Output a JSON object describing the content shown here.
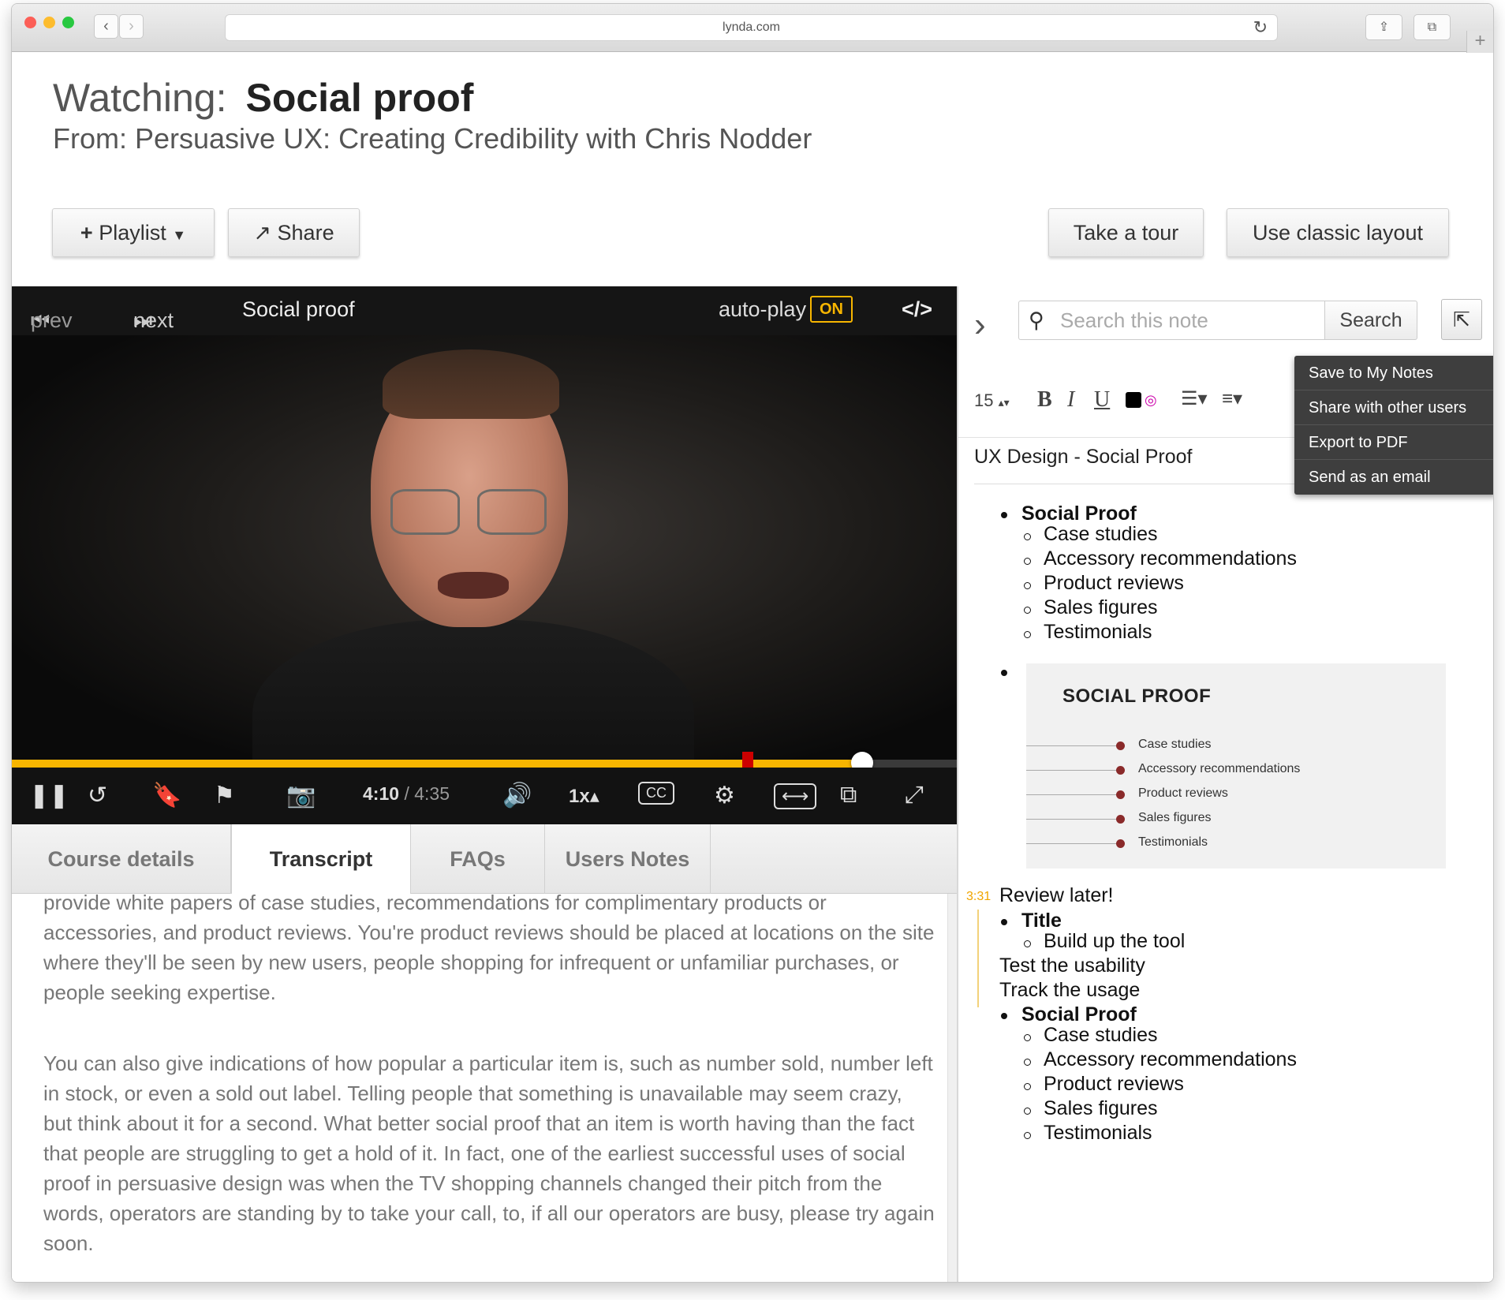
{
  "browser": {
    "url": "lynda.com",
    "back_icon": "‹",
    "forward_icon": "›",
    "reload_icon": "↻",
    "share_icon": "⇪",
    "tabs_icon": "⧉",
    "new_tab_icon": "+"
  },
  "header": {
    "watching_label": "Watching:",
    "title": "Social proof",
    "from": "From: Persuasive UX: Creating Credibility with Chris Nodder"
  },
  "actions": {
    "playlist": "Playlist",
    "share": "Share",
    "tour": "Take a tour",
    "classic": "Use classic layout"
  },
  "player": {
    "prev": "prev",
    "next": "next",
    "title": "Social proof",
    "autoplay": "auto-play",
    "autoplay_state": "ON",
    "embed_icon": "</>",
    "progress_fraction": 0.9,
    "time_current": "4:10",
    "time_total": "/ 4:35",
    "speed": "1x",
    "cc": "CC"
  },
  "tabs": [
    {
      "label": "Course details"
    },
    {
      "label": "Transcript"
    },
    {
      "label": "FAQs"
    },
    {
      "label": "Users Notes"
    }
  ],
  "transcript": {
    "p1": "provide white papers of case studies, recommendations for complimentary products or accessories, and product reviews. You're product reviews should be placed at locations on the site where they'll be seen by new users, people shopping for infrequent or unfamiliar purchases, or people seeking expertise.",
    "p2": "You can also give indications of how popular a particular item is, such as number sold, number left in stock, or even a sold out label. Telling people that something is unavailable may seem crazy, but think about it for a second. What better social proof that an item is worth having than the fact that people are struggling to get a hold of it. In fact, one of the earliest successful uses of social proof in persuasive design was when the TV shopping channels changed their pitch from the words, operators are standing by to take your call, to, if all our operators are busy, please try again soon."
  },
  "notes": {
    "search_placeholder": "Search this note",
    "search_button": "Search",
    "font_size": "15",
    "bold": "B",
    "italic": "I",
    "underline": "U",
    "menu": [
      "Save to My Notes",
      "Share with other users",
      "Export to PDF",
      "Send as an email"
    ],
    "title": "UX Design - Social Proof",
    "list1_head": "Social Proof",
    "list1_items": [
      "Case studies",
      "Accessory recommendations",
      "Product reviews",
      "Sales figures",
      "Testimonials"
    ],
    "image": {
      "title": "SOCIAL PROOF",
      "items": [
        "Case studies",
        "Accessory recommendations",
        "Product reviews",
        "Sales figures",
        "Testimonials"
      ]
    },
    "timestamp": "3:31",
    "review": "Review later!",
    "title_bullet": "Title",
    "build": "Build up the tool",
    "test": "Test the usability",
    "track": "Track the usage",
    "list2_head": "Social Proof",
    "list2_items": [
      "Case studies",
      "Accessory recommendations",
      "Product reviews",
      "Sales figures",
      "Testimonials"
    ]
  }
}
